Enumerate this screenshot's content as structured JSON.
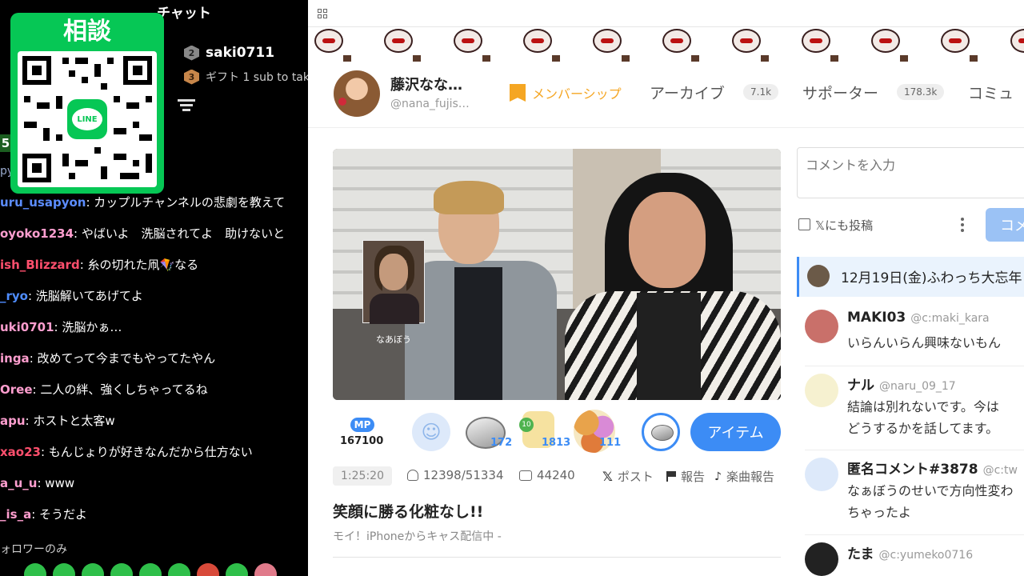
{
  "chat": {
    "title": "チャット",
    "gift_user": "saki0711",
    "gift_user_rank": "2",
    "gift_message": "ギフト 1 sub to tak",
    "gift_message_rank": "3",
    "left_badge": "5",
    "left_badge2": "py",
    "qr_title": "相談",
    "qr_logo": "LINE",
    "messages": [
      {
        "user": "uru_usapyon",
        "text": ": カップルチャンネルの悲劇を教えて",
        "color": "#5c8dff"
      },
      {
        "user": "oyoko1234",
        "text": ": やばいよ　洗脳されてよ　助けないと",
        "color": "#ff9ecf"
      },
      {
        "user": "ish_Blizzard",
        "text": ": 糸の切れた凧🪁なる",
        "color": "#ff4f6d"
      },
      {
        "user": "_ryo",
        "text": ": 洗脳解いてあげてよ",
        "color": "#4f8dff"
      },
      {
        "user": "uki0701",
        "text": ": 洗脳かぁ…",
        "color": "#ff9ecf"
      },
      {
        "user": "inga",
        "text": ": 改めてって今までもやってたやん",
        "color": "#ff9ecf"
      },
      {
        "user": "Oree",
        "text": ": 二人の絆、強くしちゃってるね",
        "color": "#ff9ecf"
      },
      {
        "user": "apu",
        "text": ": ホストと太客w",
        "color": "#ff9ecf"
      },
      {
        "user": "xao23",
        "text": ": もんじょりが好きなんだから仕方ない",
        "color": "#ff4f6d"
      },
      {
        "user": "a_u_u",
        "text": ": www",
        "color": "#ff9ecf"
      },
      {
        "user": "_is_a",
        "text": ": そうだよ",
        "color": "#ff9ecf"
      }
    ],
    "footer": "ォロワーのみ"
  },
  "page": {
    "profile": {
      "name": "藤沢なな…",
      "handle": "@nana_fujis…",
      "membership": "メンバーシップ",
      "tabs": [
        {
          "label": "アーカイブ",
          "count": "7.1k"
        },
        {
          "label": "サポーター",
          "count": "178.3k"
        },
        {
          "label": "コミュ",
          "count": ""
        }
      ]
    },
    "video": {
      "pip_label": "なあぼう"
    },
    "items": {
      "mp_badge": "MP",
      "mp_value": "167100",
      "counts": [
        "172",
        "1813",
        "111"
      ],
      "tea_level": "10",
      "button": "アイテム"
    },
    "stats": {
      "elapsed": "1:25:20",
      "viewers": "12398/51334",
      "comments": "44240",
      "post": "ポスト",
      "report": "報告",
      "music_report": "楽曲報告"
    },
    "stream_title": "笑顔に勝る化粧なし!!",
    "stream_subtitle": "モイ！iPhoneからキャス配信中 -",
    "sidebar": {
      "comment_placeholder": "コメントを入力",
      "x_post_label": "𝕏にも投稿",
      "post_button": "コメ",
      "notice": "12月19日(金)ふわっち大忘年",
      "comments": [
        {
          "name": "MAKI03",
          "handle": "@c:maki_kara",
          "text": [
            "いらんいらん興味ないもん"
          ],
          "avatar_color": "#c9706a"
        },
        {
          "name": "ナル",
          "handle": "@naru_09_17",
          "text": [
            "結論は別れないです。今は",
            "どうするかを話してます。"
          ],
          "avatar_color": "#f6f1d0"
        },
        {
          "name": "匿名コメント#3878",
          "handle": "@c:tw",
          "text": [
            "なぁぼうのせいで方向性変わ",
            "ちゃったよ"
          ],
          "avatar_color": "#dde9fa"
        },
        {
          "name": "たま",
          "handle": "@c:yumeko0716",
          "text": [
            ""
          ],
          "avatar_color": "#222222"
        }
      ]
    }
  },
  "colors": {
    "accent": "#3c8cf5",
    "line_green": "#06c755",
    "membership": "#f5a623"
  }
}
